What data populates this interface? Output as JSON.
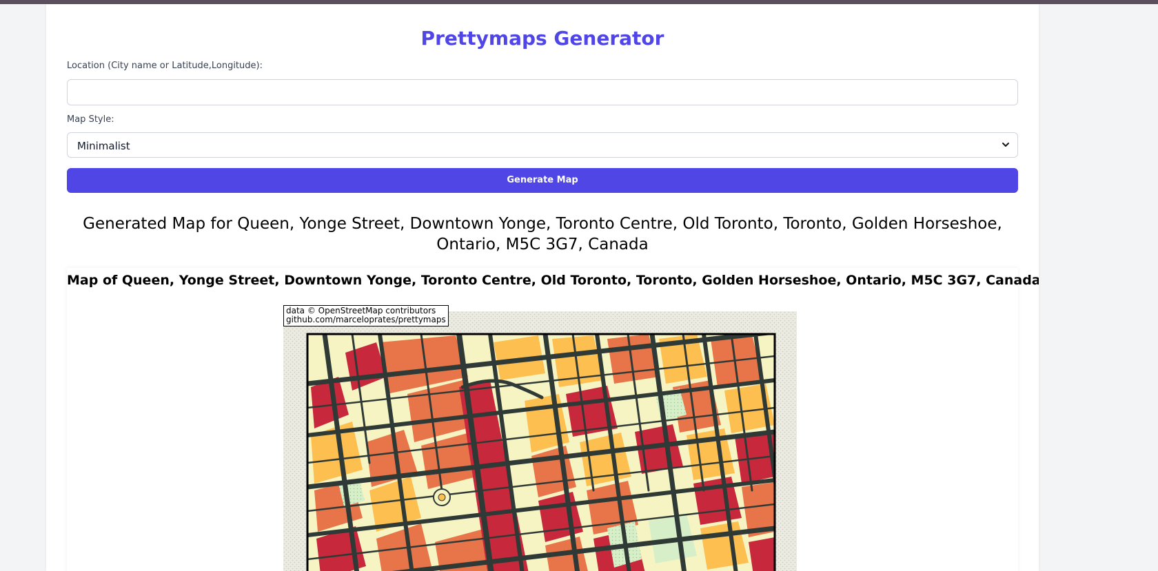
{
  "app": {
    "title": "Prettymaps Generator"
  },
  "form": {
    "location_label": "Location (City name or Latitude,Longitude):",
    "location_value": "",
    "style_label": "Map Style:",
    "style_selected": "Minimalist",
    "generate_label": "Generate Map"
  },
  "result": {
    "heading": "Generated Map for Queen, Yonge Street, Downtown Yonge, Toronto Centre, Old Toronto, Toronto, Golden Horseshoe, Ontario, M5C 3G7, Canada",
    "map_title": "Map of Queen, Yonge Street, Downtown Yonge, Toronto Centre, Old Toronto, Toronto, Golden Horseshoe, Ontario, M5C 3G7, Canada",
    "attribution_line1": "data © OpenStreetMap contributors",
    "attribution_line2": "github.com/marceloprates/prettymaps"
  },
  "colors": {
    "accent": "#4f46e5",
    "building_red": "#c8283c",
    "building_orange": "#e8744a",
    "building_yellow": "#fdbf50",
    "building_cream": "#f7f4c4",
    "park_green": "#d6efc8",
    "street": "#2f3a36",
    "background": "#e8e6db"
  },
  "icons": {
    "select_arrow": "chevron-down-icon"
  }
}
